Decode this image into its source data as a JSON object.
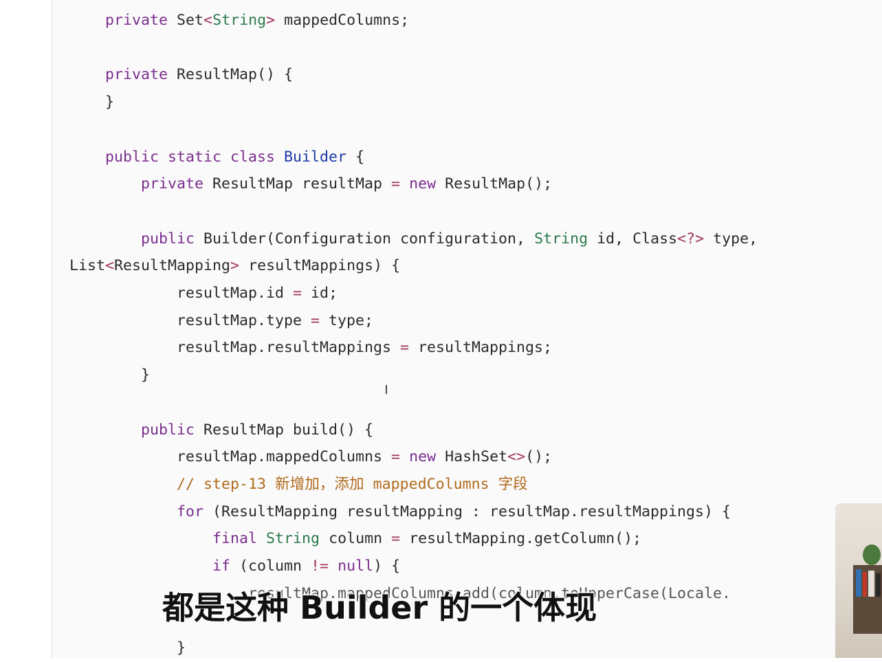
{
  "code_lines": [
    {
      "tokens": [
        {
          "t": "    ",
          "c": ""
        },
        {
          "t": "private",
          "c": "kw"
        },
        {
          "t": " Set",
          "c": ""
        },
        {
          "t": "<",
          "c": "op"
        },
        {
          "t": "String",
          "c": "ty"
        },
        {
          "t": ">",
          "c": "op"
        },
        {
          "t": " mappedColumns;",
          "c": ""
        }
      ]
    },
    {
      "tokens": []
    },
    {
      "tokens": [
        {
          "t": "    ",
          "c": ""
        },
        {
          "t": "private",
          "c": "kw"
        },
        {
          "t": " ResultMap() {",
          "c": ""
        }
      ]
    },
    {
      "tokens": [
        {
          "t": "    }",
          "c": ""
        }
      ]
    },
    {
      "tokens": []
    },
    {
      "tokens": [
        {
          "t": "    ",
          "c": ""
        },
        {
          "t": "public static class",
          "c": "kw"
        },
        {
          "t": " ",
          "c": ""
        },
        {
          "t": "Builder",
          "c": "cls"
        },
        {
          "t": " {",
          "c": ""
        }
      ]
    },
    {
      "tokens": [
        {
          "t": "        ",
          "c": ""
        },
        {
          "t": "private",
          "c": "kw"
        },
        {
          "t": " ResultMap resultMap ",
          "c": ""
        },
        {
          "t": "=",
          "c": "op"
        },
        {
          "t": " ",
          "c": ""
        },
        {
          "t": "new",
          "c": "kw"
        },
        {
          "t": " ResultMap();",
          "c": ""
        }
      ]
    },
    {
      "tokens": []
    },
    {
      "tokens": [
        {
          "t": "        ",
          "c": ""
        },
        {
          "t": "public",
          "c": "kw"
        },
        {
          "t": " Builder(Configuration configuration, ",
          "c": ""
        },
        {
          "t": "String",
          "c": "ty"
        },
        {
          "t": " id, Class",
          "c": ""
        },
        {
          "t": "<?>",
          "c": "op"
        },
        {
          "t": " type,",
          "c": ""
        }
      ]
    },
    {
      "tokens": [
        {
          "t": "List",
          "c": ""
        },
        {
          "t": "<",
          "c": "op"
        },
        {
          "t": "ResultMapping",
          "c": ""
        },
        {
          "t": ">",
          "c": "op"
        },
        {
          "t": " resultMappings) {",
          "c": ""
        }
      ]
    },
    {
      "tokens": [
        {
          "t": "            resultMap.id ",
          "c": ""
        },
        {
          "t": "=",
          "c": "op"
        },
        {
          "t": " id;",
          "c": ""
        }
      ]
    },
    {
      "tokens": [
        {
          "t": "            resultMap.type ",
          "c": ""
        },
        {
          "t": "=",
          "c": "op"
        },
        {
          "t": " type;",
          "c": ""
        }
      ]
    },
    {
      "tokens": [
        {
          "t": "            resultMap.resultMappings ",
          "c": ""
        },
        {
          "t": "=",
          "c": "op"
        },
        {
          "t": " resultMappings;",
          "c": ""
        }
      ]
    },
    {
      "tokens": [
        {
          "t": "        }",
          "c": ""
        }
      ]
    },
    {
      "tokens": []
    },
    {
      "tokens": [
        {
          "t": "        ",
          "c": ""
        },
        {
          "t": "public",
          "c": "kw"
        },
        {
          "t": " ResultMap build() {",
          "c": ""
        }
      ]
    },
    {
      "tokens": [
        {
          "t": "            resultMap.mappedColumns ",
          "c": ""
        },
        {
          "t": "=",
          "c": "op"
        },
        {
          "t": " ",
          "c": ""
        },
        {
          "t": "new",
          "c": "kw"
        },
        {
          "t": " HashSet",
          "c": ""
        },
        {
          "t": "<>",
          "c": "op"
        },
        {
          "t": "();",
          "c": ""
        }
      ]
    },
    {
      "tokens": [
        {
          "t": "            ",
          "c": ""
        },
        {
          "t": "// step-13 新增加，添加 mappedColumns 字段",
          "c": "cm"
        }
      ]
    },
    {
      "tokens": [
        {
          "t": "            ",
          "c": ""
        },
        {
          "t": "for",
          "c": "kw"
        },
        {
          "t": " (ResultMapping resultMapping : resultMap.resultMappings) {",
          "c": ""
        }
      ]
    },
    {
      "tokens": [
        {
          "t": "                ",
          "c": ""
        },
        {
          "t": "final",
          "c": "kw"
        },
        {
          "t": " ",
          "c": ""
        },
        {
          "t": "String",
          "c": "ty"
        },
        {
          "t": " column ",
          "c": ""
        },
        {
          "t": "=",
          "c": "op"
        },
        {
          "t": " resultMapping.getColumn();",
          "c": ""
        }
      ]
    },
    {
      "tokens": [
        {
          "t": "                ",
          "c": ""
        },
        {
          "t": "if",
          "c": "kw"
        },
        {
          "t": " (column ",
          "c": ""
        },
        {
          "t": "!=",
          "c": "op"
        },
        {
          "t": " ",
          "c": ""
        },
        {
          "t": "null",
          "c": "kw"
        },
        {
          "t": ") {",
          "c": ""
        }
      ]
    },
    {
      "tokens": [
        {
          "t": "                    resultMap.mappedColumns.add(column.toUpperCase(Locale.",
          "c": "ghost"
        }
      ]
    },
    {
      "tokens": []
    },
    {
      "tokens": [
        {
          "t": "            }",
          "c": ""
        }
      ]
    }
  ],
  "subtitle": "都是这种 Builder 的一个体现"
}
